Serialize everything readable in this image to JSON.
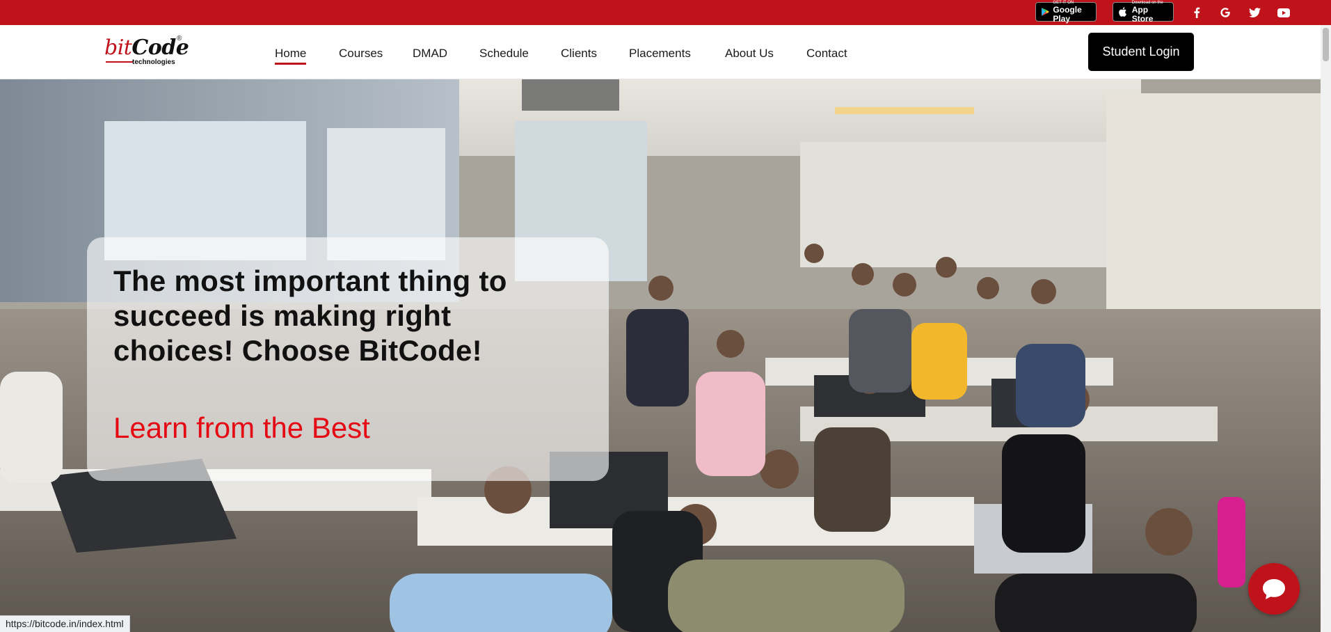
{
  "topbar": {
    "google_play": {
      "small": "GET IT ON",
      "big": "Google Play"
    },
    "app_store": {
      "small": "Download on the",
      "big": "App Store"
    },
    "social_icons": [
      "facebook-icon",
      "google-icon",
      "twitter-icon",
      "youtube-icon"
    ]
  },
  "header": {
    "logo": {
      "bit": "bit",
      "code": "Code",
      "sub": "technologies",
      "reg": "®"
    },
    "nav": [
      "Home",
      "Courses",
      "DMAD",
      "Schedule",
      "Clients",
      "Placements",
      "About Us",
      "Contact"
    ],
    "active_nav": "Home",
    "login_label": "Student Login"
  },
  "hero": {
    "heading": "The most important thing to succeed is making right choices! Choose BitCode!",
    "subheading": "Learn from the Best"
  },
  "chat": {
    "icon": "chat-bubble-icon"
  },
  "status_bar": {
    "url": "https://bitcode.in/index.html"
  },
  "colors": {
    "brand_red": "#c0121a",
    "accent_red": "#e50914",
    "button_black": "#000000"
  }
}
